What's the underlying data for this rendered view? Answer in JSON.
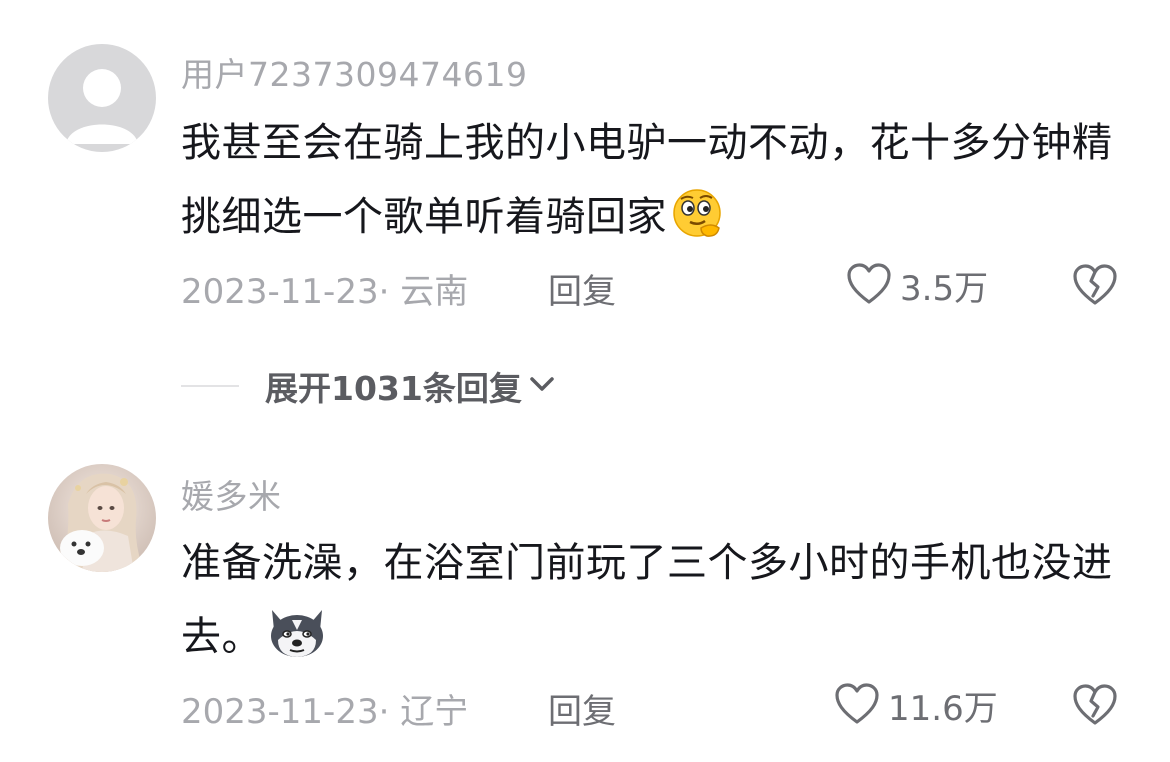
{
  "comments": [
    {
      "username": "用户7237309474619",
      "text": "我甚至会在骑上我的小电驴一动不动，花十多分钟精挑细选一个歌单听着骑回家",
      "emoji": "thinking-face-emoji",
      "date_location": "2023-11-23· 云南",
      "reply_label": "回复",
      "like_count": "3.5万",
      "avatar": "default-avatar"
    },
    {
      "username": "媛多米",
      "text": "准备洗澡，在浴室门前玩了三个多小时的手机也没进去。",
      "emoji": "husky-dog-emoji",
      "date_location": "2023-11-23· 辽宁",
      "reply_label": "回复",
      "like_count": "11.6万",
      "avatar": "profile-photo-avatar"
    }
  ],
  "expand_replies_label": "展开1031条回复",
  "icons": {
    "like": "heart-outline-icon",
    "dislike": "broken-heart-icon",
    "expand": "chevron-down-icon"
  },
  "colors": {
    "text": "#16171c",
    "muted": "#a7a8ad",
    "action": "#6d6e73"
  }
}
